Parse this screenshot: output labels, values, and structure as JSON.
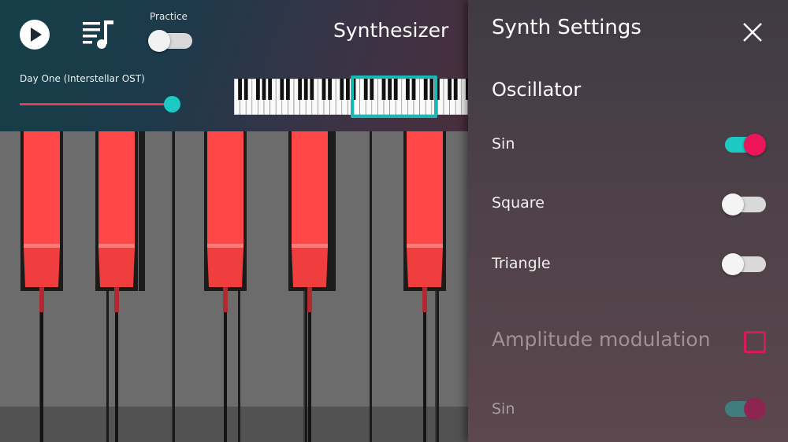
{
  "header": {
    "app_title": "Synthesizer",
    "practice_label": "Practice",
    "practice_on": false,
    "song_title": "Day One (Interstellar OST)",
    "progress": 0.93
  },
  "icons": {
    "play": "play-icon",
    "playlist": "playlist-icon",
    "close": "close-icon"
  },
  "colors": {
    "accent_teal": "#1dc9c3",
    "accent_pink": "#ec1559",
    "highlight_key": "#ff4747"
  },
  "settings": {
    "title": "Synth Settings",
    "oscillator_title": "Oscillator",
    "oscillators": [
      {
        "label": "Sin",
        "on": true
      },
      {
        "label": "Square",
        "on": false
      },
      {
        "label": "Triangle",
        "on": false
      }
    ],
    "amplitude_modulation": {
      "label": "Amplitude modulation",
      "checked": false,
      "waves": [
        {
          "label": "Sin",
          "on": true
        }
      ]
    }
  }
}
